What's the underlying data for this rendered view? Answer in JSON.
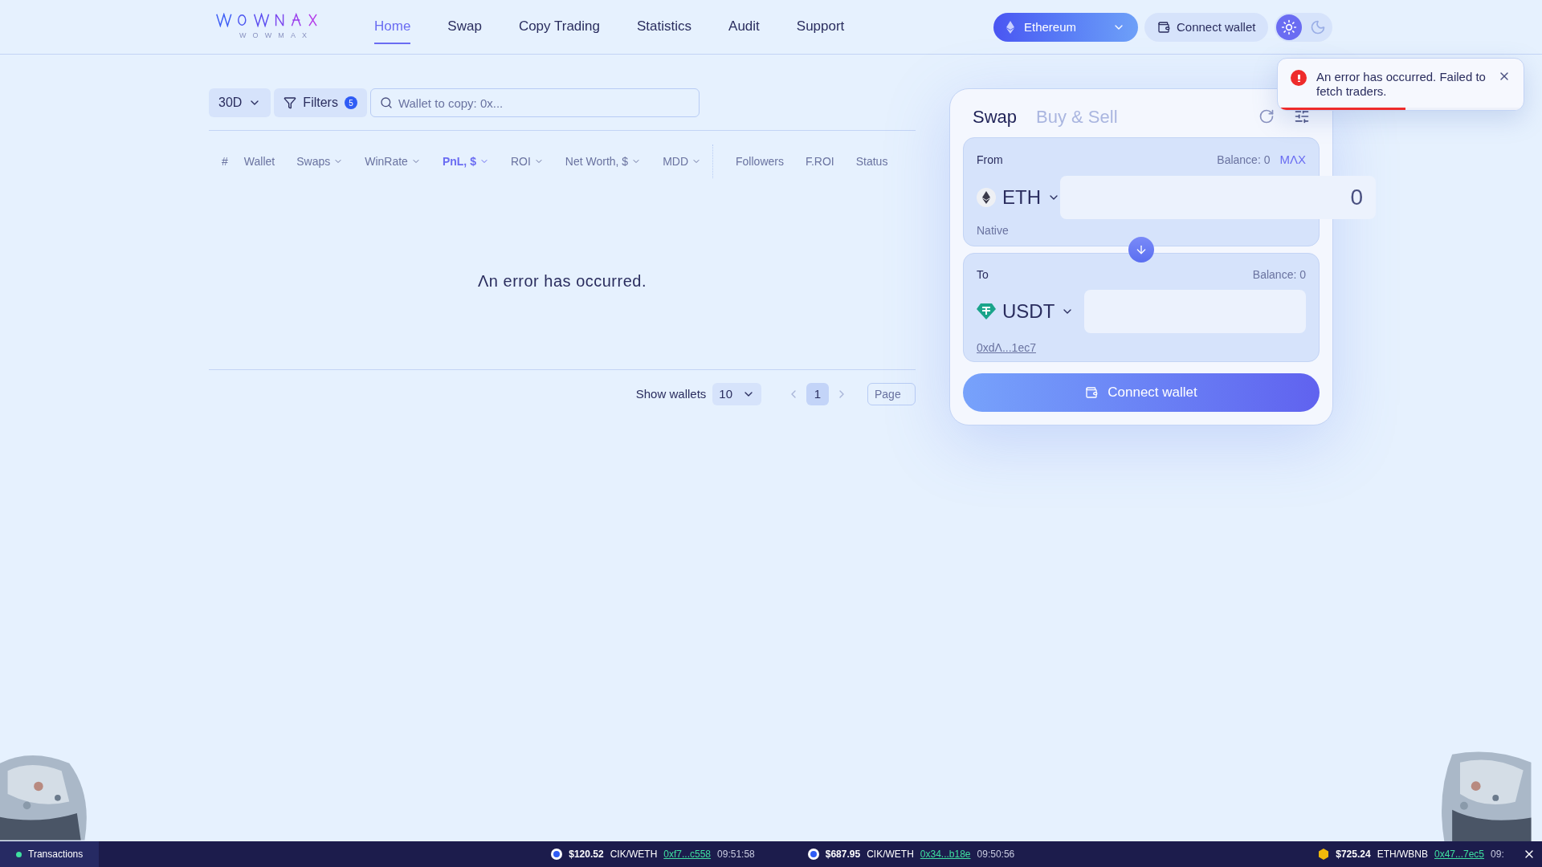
{
  "header": {
    "logo_text": "WOWMAX",
    "nav": [
      {
        "label": "Home",
        "selected": true
      },
      {
        "label": "Swap",
        "selected": false
      },
      {
        "label": "Copy Trading",
        "selected": false
      },
      {
        "label": "Statistics",
        "selected": false
      },
      {
        "label": "Audit",
        "selected": false
      },
      {
        "label": "Support",
        "selected": false
      }
    ],
    "network": "Ethereum",
    "connect_label": "Connect wallet",
    "theme": [
      {
        "kind": "light",
        "selected": true
      },
      {
        "kind": "dark",
        "selected": false
      }
    ]
  },
  "toolbar": {
    "period": "30D",
    "filters_label": "Filters",
    "filters_count": "5",
    "search_placeholder": "Wallet to copy: 0x..."
  },
  "table": {
    "columns": [
      {
        "label": "#",
        "sortable": false,
        "selected": false,
        "divider_before": false
      },
      {
        "label": "Wallet",
        "sortable": false,
        "selected": false,
        "divider_before": false
      },
      {
        "label": "Swaps",
        "sortable": true,
        "selected": false,
        "divider_before": false
      },
      {
        "label": "WinRate",
        "sortable": true,
        "selected": false,
        "divider_before": false
      },
      {
        "label": "PnL, $",
        "sortable": true,
        "selected": true,
        "divider_before": false
      },
      {
        "label": "ROI",
        "sortable": true,
        "selected": false,
        "divider_before": false
      },
      {
        "label": "Net Worth, $",
        "sortable": true,
        "selected": false,
        "divider_before": false
      },
      {
        "label": "MDD",
        "sortable": true,
        "selected": false,
        "divider_before": false
      },
      {
        "label": "Followers",
        "sortable": false,
        "selected": false,
        "divider_before": true
      },
      {
        "label": "F.ROI",
        "sortable": false,
        "selected": false,
        "divider_before": false
      },
      {
        "label": "Status",
        "sortable": false,
        "selected": false,
        "divider_before": false
      }
    ],
    "message": "Λn error has occurred."
  },
  "pagination": {
    "show_label": "Show wallets",
    "page_size": "10",
    "pages": [
      {
        "label": "1",
        "selected": true
      }
    ],
    "page_placeholder": "Page"
  },
  "swap": {
    "tabs": [
      {
        "label": "Swap",
        "selected": true
      },
      {
        "label": "Buy & Sell",
        "selected": false
      }
    ],
    "from": {
      "label": "From",
      "balance": "Balance: 0",
      "max": "MΛX",
      "token": "ETH",
      "amount": "0",
      "note": "Native"
    },
    "to": {
      "label": "To",
      "balance": "Balance: 0",
      "token": "USDT",
      "address": "0xdΛ...1ec7"
    },
    "connect_label": "Connect wallet"
  },
  "toast": {
    "message": "An error has occurred. Failed to fetch traders.",
    "level": 0.52
  },
  "status_bar": {
    "tab": "Transactions",
    "items": [
      {
        "kind": "circle",
        "amount": "$120.52",
        "pair": "CIK/WETH",
        "address": "0xf7...c558",
        "time": "09:51:58"
      },
      {
        "kind": "circle",
        "amount": "$687.95",
        "pair": "CIK/WETH",
        "address": "0x34...b18e",
        "time": "09:50:56"
      },
      {
        "kind": "cube",
        "amount": "$725.24",
        "pair": "ETH/WBNB",
        "address": "0x47...7ec5",
        "time": "09:"
      }
    ]
  }
}
